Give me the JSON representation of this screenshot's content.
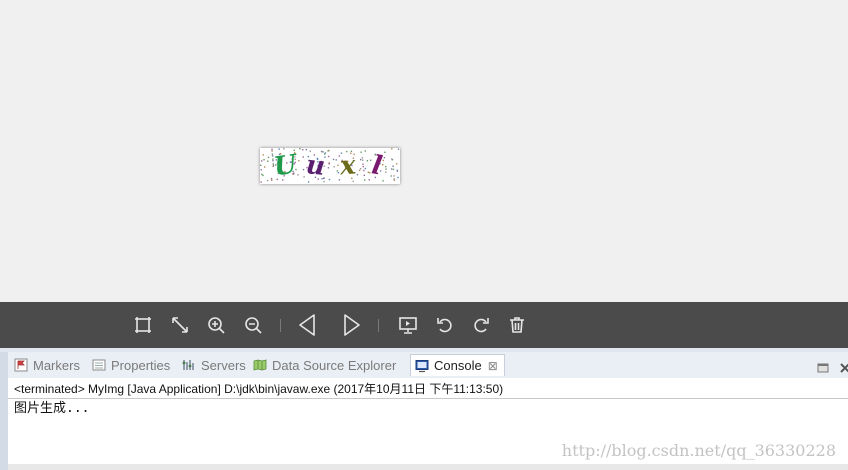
{
  "captcha": {
    "characters": [
      {
        "char": "U",
        "color": "#1e9a4a"
      },
      {
        "char": "u",
        "color": "#5a1f6e"
      },
      {
        "char": "x",
        "color": "#6b6b1a"
      },
      {
        "char": "l",
        "color": "#7a1a6e"
      }
    ]
  },
  "toolbar": {
    "buttons": [
      {
        "name": "fit-to-window-icon"
      },
      {
        "name": "actual-size-icon"
      },
      {
        "name": "zoom-in-icon"
      },
      {
        "name": "zoom-out-icon"
      },
      {
        "name": "previous-image-icon"
      },
      {
        "name": "next-image-icon"
      },
      {
        "name": "slideshow-icon"
      },
      {
        "name": "rotate-left-icon"
      },
      {
        "name": "rotate-right-icon"
      },
      {
        "name": "delete-icon"
      }
    ],
    "icon_color": "#e6e6e6"
  },
  "console_panel": {
    "tabs": [
      {
        "label": "Markers",
        "active": false
      },
      {
        "label": "Properties",
        "active": false
      },
      {
        "label": "Servers",
        "active": false
      },
      {
        "label": "Data Source Explorer",
        "active": false
      },
      {
        "label": "Console",
        "active": true
      }
    ],
    "status": "<terminated> MyImg [Java Application] D:\\jdk\\bin\\javaw.exe (2017年10月11日 下午11:13:50)",
    "output": "图片生成...",
    "watermark": "http://blog.csdn.net/qq_36330228"
  }
}
